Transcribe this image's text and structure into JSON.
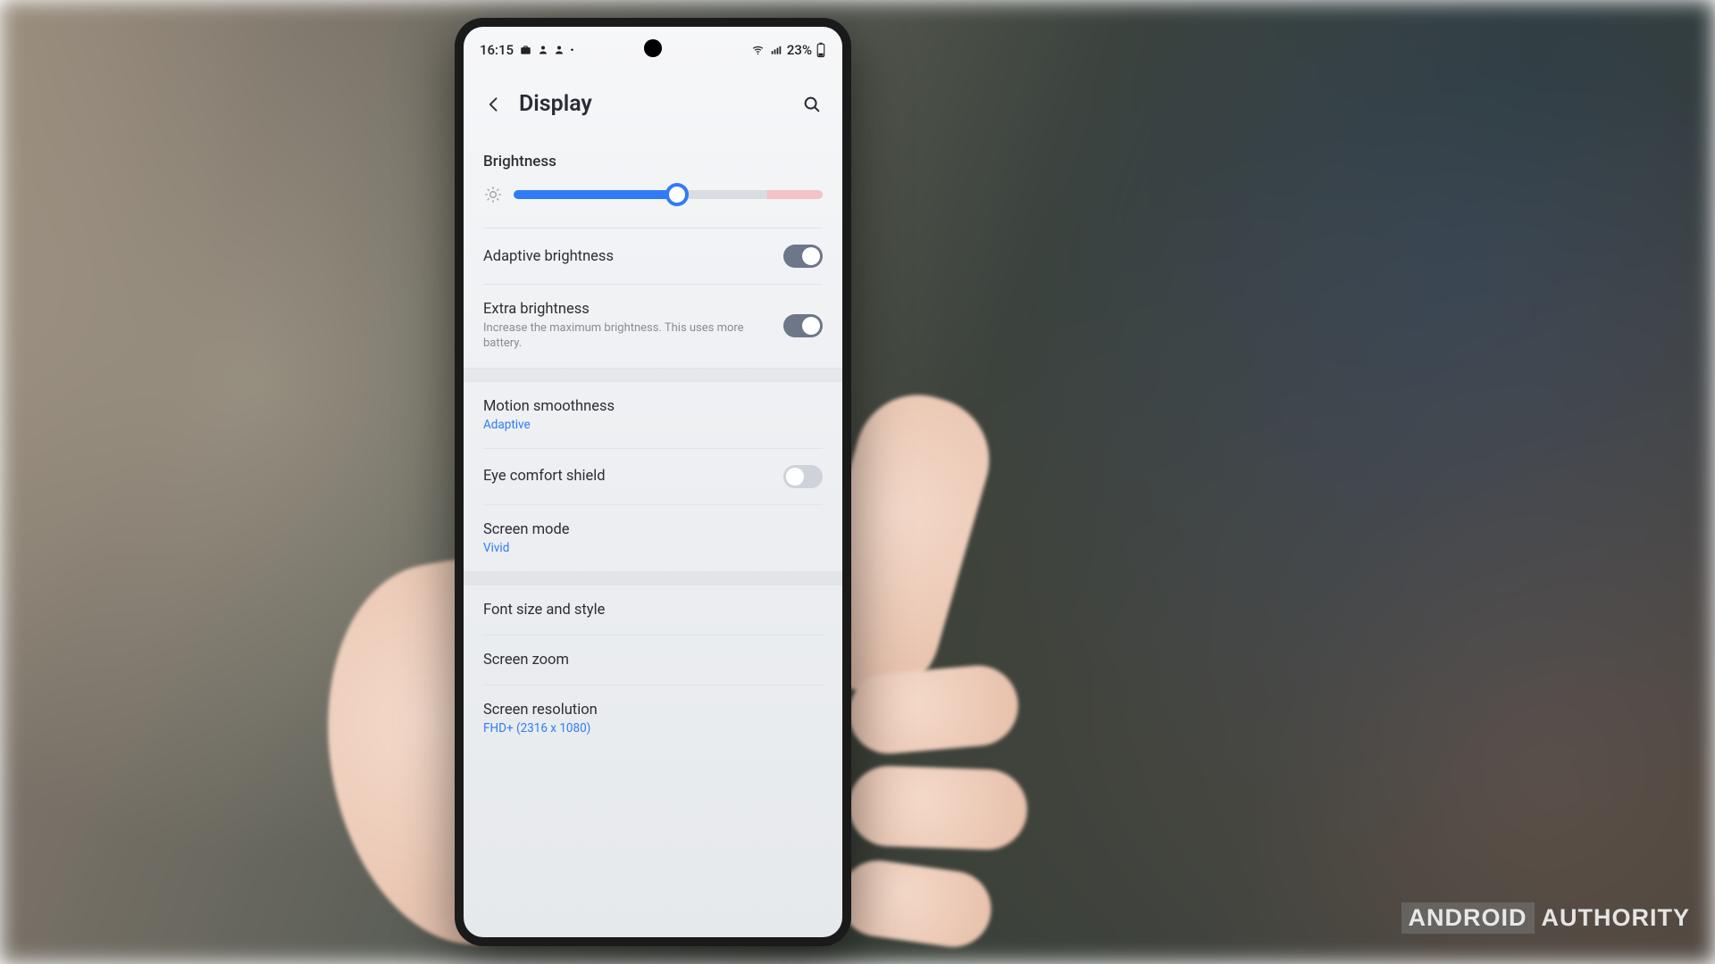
{
  "status": {
    "time": "16:15",
    "battery_text": "23%"
  },
  "header": {
    "title": "Display"
  },
  "brightness": {
    "section_label": "Brightness",
    "slider_percent": 53
  },
  "rows": {
    "adaptive": {
      "label": "Adaptive brightness",
      "on": true
    },
    "extra": {
      "label": "Extra brightness",
      "sub": "Increase the maximum brightness. This uses more battery.",
      "on": true
    },
    "motion": {
      "label": "Motion smoothness",
      "value": "Adaptive"
    },
    "eyecomfort": {
      "label": "Eye comfort shield",
      "on": false
    },
    "screenmode": {
      "label": "Screen mode",
      "value": "Vivid"
    },
    "font": {
      "label": "Font size and style"
    },
    "zoom": {
      "label": "Screen zoom"
    },
    "resolution": {
      "label": "Screen resolution",
      "value": "FHD+ (2316 x 1080)"
    }
  },
  "watermark": {
    "boxed": "ANDROID",
    "rest": "AUTHORITY"
  }
}
